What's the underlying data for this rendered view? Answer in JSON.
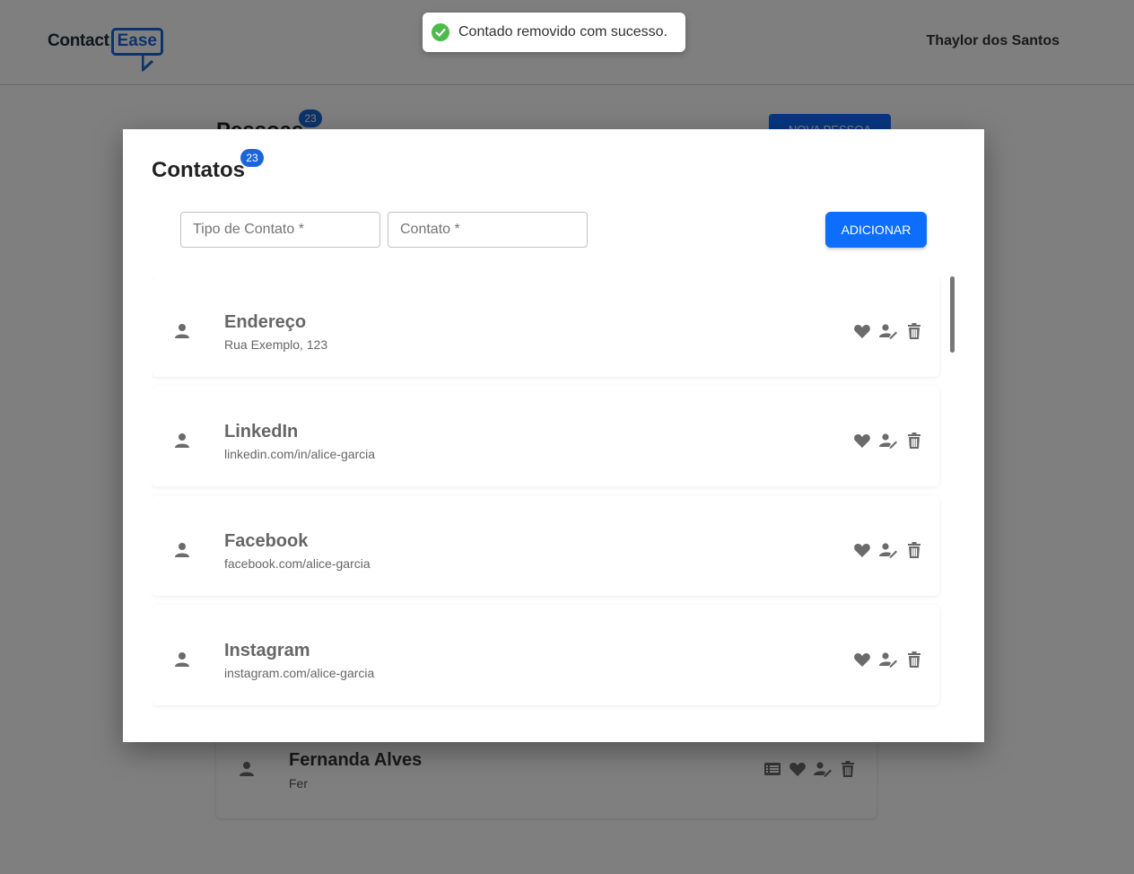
{
  "header": {
    "logo_contact": "Contact",
    "logo_ease": "Ease",
    "user_name": "Thaylor dos Santos"
  },
  "background_page": {
    "title": "Pessoas",
    "count_badge": "23",
    "new_button_label": "NOVA PESSOA",
    "visible_person": {
      "name": "Fernanda Alves",
      "nickname": "Fer"
    }
  },
  "modal": {
    "title": "Contatos",
    "count_badge": "23",
    "contact_type_placeholder": "Tipo de Contato *",
    "contact_placeholder": "Contato *",
    "add_button_label": "ADICIONAR",
    "contacts": [
      {
        "type": "Endereço",
        "value": "Rua Exemplo, 123"
      },
      {
        "type": "LinkedIn",
        "value": "linkedin.com/in/alice-garcia"
      },
      {
        "type": "Facebook",
        "value": "facebook.com/alice-garcia"
      },
      {
        "type": "Instagram",
        "value": "instagram.com/alice-garcia"
      }
    ]
  },
  "toast": {
    "message": "Contado removido com sucesso.",
    "status": "success"
  },
  "colors": {
    "primary": "#0d6efd",
    "badge": "#1a66d6",
    "success": "#4cbb4a",
    "icon_gray": "#6b6b6b",
    "overlay": "rgba(0,0,0,0.5)"
  },
  "icons": {
    "contact_avatar": "person-icon",
    "favorite": "heart-icon",
    "edit": "user-edit-icon",
    "delete": "trash-icon",
    "details": "list-icon",
    "toast": "check-circle-icon"
  }
}
